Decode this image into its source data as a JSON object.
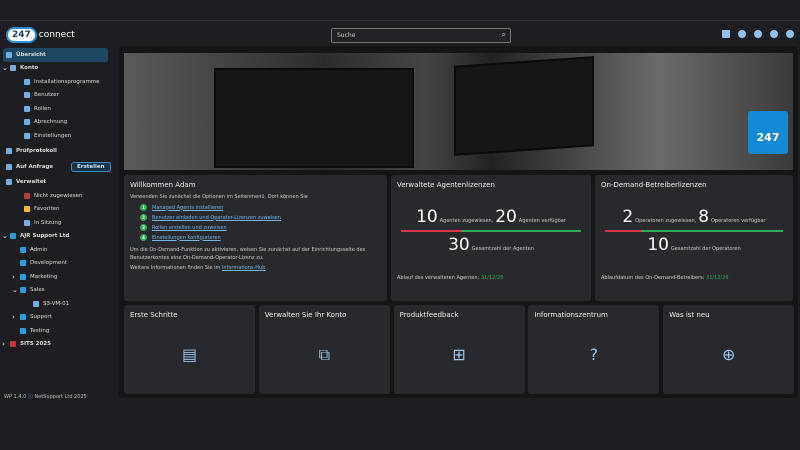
{
  "header": {
    "logo_badge": "247",
    "logo_text": "connect",
    "search_placeholder": "Suche",
    "icons": [
      "chat-icon",
      "account-icon",
      "theme-icon",
      "help-icon",
      "settings-icon"
    ]
  },
  "sidebar": {
    "items": [
      {
        "label": "Übersicht",
        "indent": 0,
        "icon": "dashboard-icon",
        "active": true
      },
      {
        "label": "Konto",
        "indent": 1,
        "icon": "org-icon",
        "chevron": "down"
      },
      {
        "label": "Installationsprogramme",
        "indent": 2,
        "icon": "installer-icon"
      },
      {
        "label": "Benutzer",
        "indent": 2,
        "icon": "users-icon"
      },
      {
        "label": "Rollen",
        "indent": 2,
        "icon": "roles-icon"
      },
      {
        "label": "Abrechnung",
        "indent": 2,
        "icon": "billing-icon"
      },
      {
        "label": "Einstellungen",
        "indent": 2,
        "icon": "gear-icon"
      },
      {
        "label": "Prüfprotokoll",
        "indent": 0,
        "icon": "audit-icon"
      },
      {
        "label": "Auf Anfrage",
        "indent": 0,
        "icon": "transfer-icon"
      },
      {
        "label": "Verwaltet",
        "indent": 0,
        "icon": "devices-icon"
      },
      {
        "label": "Nicht zugewiesen",
        "indent": 2,
        "icon": "unassigned-icon"
      },
      {
        "label": "Favoriten",
        "indent": 2,
        "icon": "star-icon"
      },
      {
        "label": "In Sitzung",
        "indent": 2,
        "icon": "session-icon"
      },
      {
        "label": "AJR Support Ltd",
        "indent": 1,
        "icon": "folder-icon",
        "chevron": "down"
      },
      {
        "label": "Admin",
        "indent": 3,
        "icon": "folder-icon"
      },
      {
        "label": "Development",
        "indent": 3,
        "icon": "folder-icon"
      },
      {
        "label": "Marketing",
        "indent": 3,
        "icon": "folder-icon",
        "chevron": "right"
      },
      {
        "label": "Sales",
        "indent": 3,
        "icon": "folder-icon",
        "chevron": "down"
      },
      {
        "label": "S3-VM-01",
        "indent": 4,
        "icon": "computer-icon"
      },
      {
        "label": "Support",
        "indent": 3,
        "icon": "folder-icon",
        "chevron": "right"
      },
      {
        "label": "Testing",
        "indent": 3,
        "icon": "folder-icon"
      },
      {
        "label": "SITS 2025",
        "indent": 1,
        "icon": "folder-red-icon",
        "chevron": "right"
      }
    ],
    "create_label": "Erstellen",
    "footer_version": "WP 1.4.0",
    "footer_company": "NetSupport Ltd 2025"
  },
  "banner": {
    "tile_text": "247"
  },
  "welcome": {
    "title": "Willkommen Adam",
    "intro": "Verwenden Sie zunächst die Optionen im Seitenmenü. Dort können Sie",
    "steps": [
      "Managed Agents installieren",
      "Benutzer einladen und Operator-Lizenzen zuweisen",
      "Rollen erstellen und zuweisen",
      "Einstellungen konfigurieren"
    ],
    "para": "Um die On-Demand-Funktion zu aktivieren, weisen Sie zunächst auf der Einrichtungsseite des Benutzerkontos eine On-Demand-Operator-Lizenz zu.",
    "more_prefix": "Weitere Informationen finden Sie im",
    "more_link": "Informations-Hub"
  },
  "agents": {
    "title": "Verwaltete Agentenlizenzen",
    "assigned": "10",
    "assigned_label": "Agenten zugewiesen,",
    "available": "20",
    "available_label": "Agenten verfügbar",
    "total": "30",
    "total_label": "Gesamtzahl der Agenten",
    "expiry_label": "Ablauf des verwalteten Agenten:",
    "expiry": "31/12/28",
    "used_fraction": 0.333
  },
  "operators": {
    "title": "On-Demand-Betreiberlizenzen",
    "assigned": "2",
    "assigned_label": "Operatoren zugewiesen,",
    "available": "8",
    "available_label": "Operatoren verfügbar",
    "total": "10",
    "total_label": "Gesamtzahl der Operatoren",
    "expiry_label": "Ablaufdatum des On-Demand-Betreibers:",
    "expiry": "31/12/28",
    "used_fraction": 0.2
  },
  "tiles": [
    {
      "title": "Erste Schritte",
      "icon": "document-icon",
      "glyph": "▤"
    },
    {
      "title": "Verwalten Sie Ihr Konto",
      "icon": "org-chart-icon",
      "glyph": "⧉"
    },
    {
      "title": "Produktfeedback",
      "icon": "feedback-icon",
      "glyph": "⊞"
    },
    {
      "title": "Informationszentrum",
      "icon": "help-icon",
      "glyph": "?"
    },
    {
      "title": "Was ist neu",
      "icon": "globe-icon",
      "glyph": "⊕"
    }
  ],
  "colors": {
    "accent": "#1689d4",
    "used": "#d9364a",
    "free": "#2eac58",
    "link": "#74b4e6"
  }
}
